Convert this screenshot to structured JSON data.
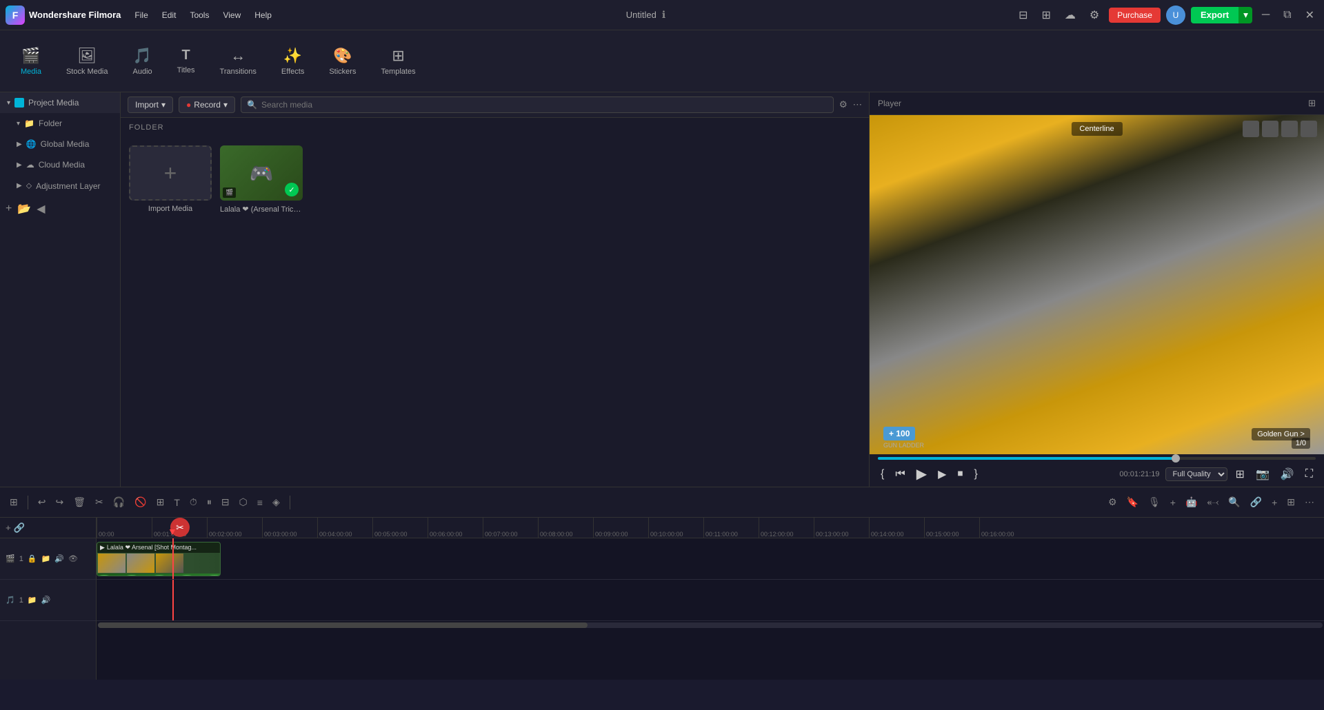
{
  "app": {
    "name": "Wondershare Filmora",
    "title": "Untitled"
  },
  "menu": {
    "items": [
      "File",
      "Edit",
      "Tools",
      "View",
      "Help"
    ]
  },
  "topbar": {
    "purchase_label": "Purchase",
    "export_label": "Export",
    "window_controls": [
      "─",
      "⧉",
      "✕"
    ]
  },
  "toolbar": {
    "items": [
      {
        "id": "media",
        "label": "Media",
        "icon": "🎬",
        "active": true
      },
      {
        "id": "stock_media",
        "label": "Stock Media",
        "icon": "🖼"
      },
      {
        "id": "audio",
        "label": "Audio",
        "icon": "🎵"
      },
      {
        "id": "titles",
        "label": "Titles",
        "icon": "T"
      },
      {
        "id": "transitions",
        "label": "Transitions",
        "icon": "↔"
      },
      {
        "id": "effects",
        "label": "Effects",
        "icon": "✨"
      },
      {
        "id": "stickers",
        "label": "Stickers",
        "icon": "🎨"
      },
      {
        "id": "templates",
        "label": "Templates",
        "icon": "⊞"
      }
    ]
  },
  "left_panel": {
    "project_media": "Project Media",
    "items": [
      {
        "label": "Folder",
        "id": "folder"
      },
      {
        "label": "Global Media",
        "id": "global_media"
      },
      {
        "label": "Cloud Media",
        "id": "cloud_media"
      },
      {
        "label": "Adjustment Layer",
        "id": "adjustment_layer"
      }
    ]
  },
  "center_panel": {
    "import_label": "Import",
    "record_label": "Record",
    "search_placeholder": "Search media",
    "folder_label": "FOLDER",
    "media_items": [
      {
        "type": "add",
        "label": "Import Media"
      },
      {
        "type": "video",
        "label": "Lalala ❤ (Arsenal Trick...",
        "selected": true
      }
    ]
  },
  "player": {
    "title": "Player",
    "time": "00:01:21:19",
    "quality": "Full Quality",
    "progress_percent": 68
  },
  "timeline": {
    "tracks": [
      {
        "id": "video1",
        "icon": "🎬",
        "label": "1"
      },
      {
        "id": "audio1",
        "icon": "🎵",
        "label": "1"
      }
    ],
    "time_markers": [
      "00:00",
      "00:01:00:00",
      "00:02:00:00",
      "00:03:00:00",
      "00:04:00:00",
      "00:05:00:00",
      "00:06:00:00",
      "00:07:00:00",
      "00:08:00:00",
      "00:09:00:00",
      "00:10:00:00",
      "00:11:00:00",
      "00:12:00:00",
      "00:13:00:00",
      "00:14:00:00",
      "00:15:00:00",
      "00:16:00:00"
    ],
    "clip_label": "Lalala ❤ Arsenal [Shot Montag..."
  }
}
